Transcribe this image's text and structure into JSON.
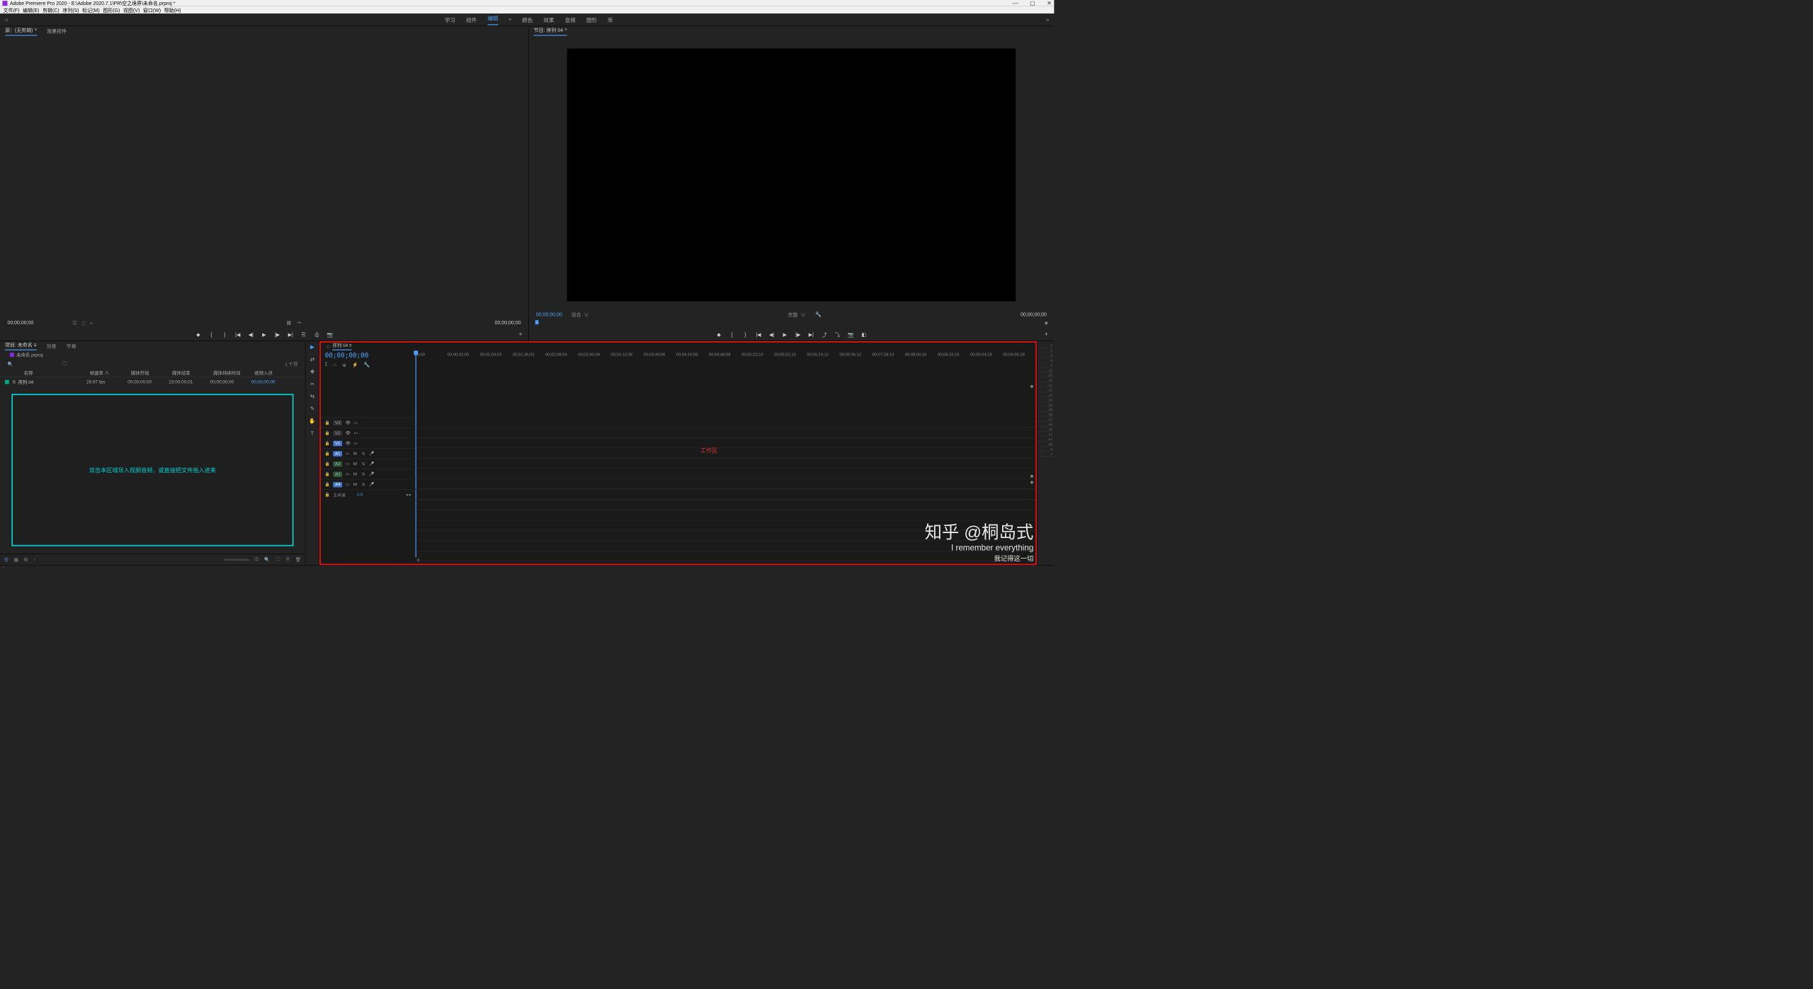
{
  "title": "Adobe Premiere Pro 2020 - E:\\Adobe 2020.7.1\\PR\\空之境界\\未命名.prproj *",
  "menus": [
    "文件(F)",
    "编辑(E)",
    "剪辑(C)",
    "序列(S)",
    "标记(M)",
    "图形(G)",
    "视图(V)",
    "窗口(W)",
    "帮助(H)"
  ],
  "workspaces": [
    "学习",
    "组件",
    "编辑",
    "颜色",
    "效果",
    "音频",
    "图形",
    "库"
  ],
  "active_workspace": "编辑",
  "source": {
    "tab": "源：(无剪辑)",
    "effects_tab": "效果控件",
    "tc_left": "00;00;00;00",
    "tc_right": "00;00;00;00"
  },
  "program": {
    "tab": "节目: 序列 04",
    "tc_left": "00;00;00;00",
    "fit": "适合",
    "scale_right": "完整",
    "tc_right": "00;00;00;00"
  },
  "project": {
    "tabs": [
      "项目: 未命名",
      "效果",
      "字幕"
    ],
    "file": "未命名.prproj",
    "search_placeholder": "",
    "item_count": "1 个项",
    "headers": [
      "名称",
      "帧速率 ∧",
      "媒体开始",
      "媒体结束",
      "媒体持续时间",
      "视频入点"
    ],
    "row": {
      "name": "序列 04",
      "fps": "29.97 fps",
      "start": "00;00;00;00",
      "end": "23;00;00;01",
      "dur": "00;00;00;00",
      "in": "00;00;00;00"
    },
    "import_hint": "双击本区域导入视频音频，或直接把文件拖入进来"
  },
  "tools": [
    "▶",
    "⇄",
    "✥",
    "✂",
    "⇆",
    "✎",
    "✋",
    "T"
  ],
  "timeline": {
    "seq": "序列 04",
    "tc": "00;00;00;00",
    "ticks": [
      "00;00",
      "00;00;32;00",
      "00;01;04;02",
      "00;01;36;02",
      "00;02;08;04",
      "00;02;40;04",
      "00;03;12;06",
      "00;03;44;06",
      "00;04;16;08",
      "00;04;48;08",
      "00;05;20;10",
      "00;05;52;10",
      "00;06;24;12",
      "00;06;56;12",
      "00;07;28;14",
      "00;08;00;16",
      "00;08;32;16",
      "00;09;04;18",
      "00;09;36;18"
    ],
    "vtracks": [
      "V3",
      "V2",
      "V1"
    ],
    "atracks": [
      "A1",
      "A2",
      "A3",
      "A4"
    ],
    "master": "主声道",
    "master_val": "0.0",
    "work_label": "工作区"
  },
  "meters": [
    "0",
    "S",
    "-3",
    "-6",
    "-9",
    "-12",
    "-15",
    "-18",
    "-21",
    "-24",
    "-27",
    "-30",
    "-33",
    "-36",
    "-39",
    "-42",
    "-45",
    "-48",
    "-51",
    "-54",
    "dB",
    "S",
    "0"
  ],
  "watermark": {
    "main": "知乎 @桐岛式",
    "sub": "I remember everything",
    "sub2": "我记得这一切"
  }
}
